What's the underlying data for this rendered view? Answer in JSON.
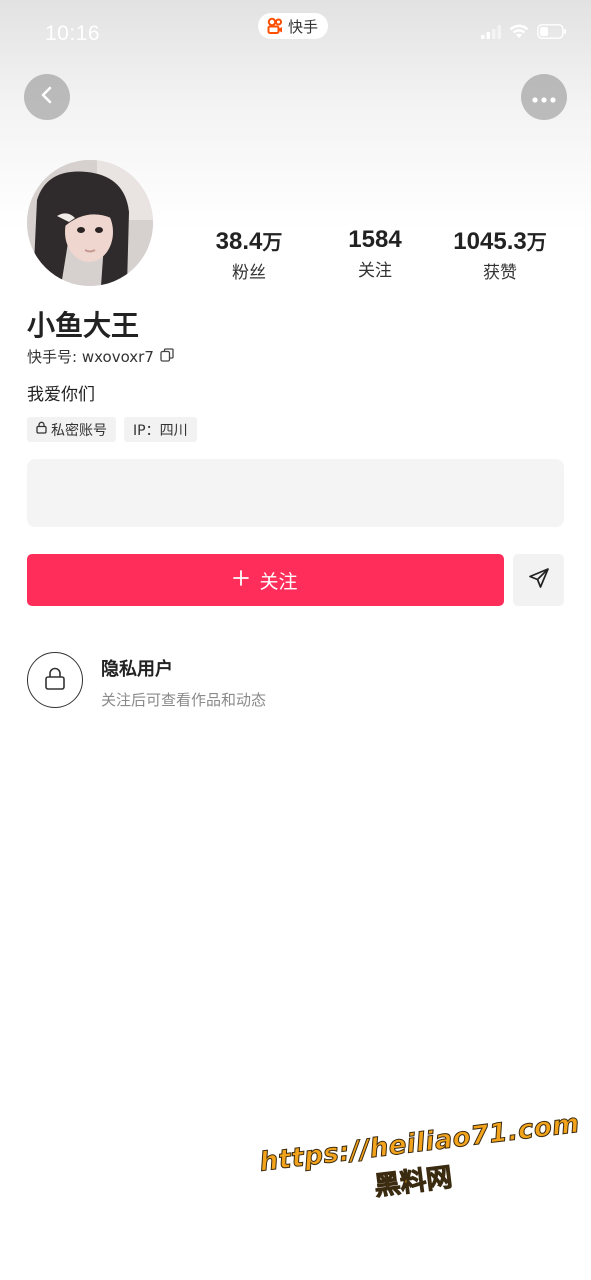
{
  "status_bar": {
    "time": "10:16",
    "app_pill_label": "快手"
  },
  "profile": {
    "nickname": "小鱼大王",
    "kwai_id_label": "快手号:",
    "kwai_id": "wxovoxr7",
    "bio": "我爱你们",
    "tags": {
      "private_account": "私密账号",
      "ip": "IP：四川"
    }
  },
  "stats": [
    {
      "value": "38.4",
      "unit": "万",
      "label": "粉丝"
    },
    {
      "value": "1584",
      "unit": "",
      "label": "关注"
    },
    {
      "value": "1045.3",
      "unit": "万",
      "label": "获赞"
    }
  ],
  "actions": {
    "follow_label": "关注"
  },
  "private_notice": {
    "title": "隐私用户",
    "description": "关注后可查看作品和动态"
  },
  "watermark": {
    "url": "https://heiliao71.com",
    "name": "黑料网"
  },
  "colors": {
    "accent": "#fe2d5a",
    "watermark": "#f2a31b"
  },
  "icons": {
    "back": "chevron-left-icon",
    "more": "more-icon",
    "copy": "copy-icon",
    "lock": "lock-icon",
    "share": "send-icon",
    "plus": "plus-icon"
  }
}
